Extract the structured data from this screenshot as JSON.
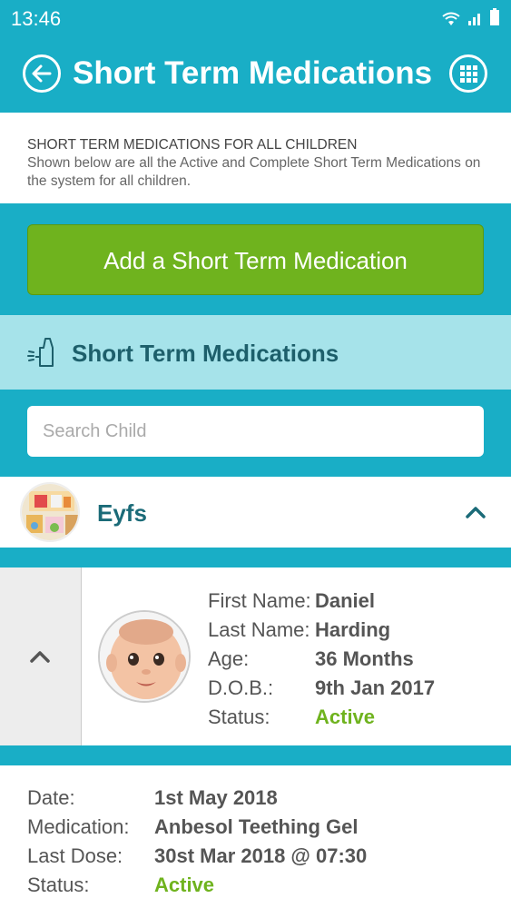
{
  "status_bar": {
    "time": "13:46"
  },
  "app_bar": {
    "title": "Short Term Medications",
    "back_icon": "back-arrow-icon",
    "menu_icon": "grid-menu-icon"
  },
  "info": {
    "heading": "SHORT TERM MEDICATIONS FOR ALL CHILDREN",
    "description": "Shown below are all the Active and Complete Short Term Medications on the system for all children."
  },
  "add_button": {
    "label": "Add a Short Term Medication"
  },
  "section": {
    "title": "Short Term Medications",
    "icon": "inhaler-icon"
  },
  "search": {
    "placeholder": "Search Child",
    "value": ""
  },
  "group": {
    "name": "Eyfs"
  },
  "child": {
    "labels": {
      "first_name": "First Name:",
      "last_name": "Last Name:",
      "age": "Age:",
      "dob": "D.O.B.:",
      "status": "Status:"
    },
    "first_name": "Daniel",
    "last_name": "Harding",
    "age": "36 Months",
    "dob": "9th Jan 2017",
    "status": "Active"
  },
  "medication": {
    "labels": {
      "date": "Date:",
      "medication": "Medication:",
      "last_dose": "Last Dose:",
      "status": "Status:"
    },
    "date": "1st May 2018",
    "name": "Anbesol Teething Gel",
    "last_dose": "30st Mar 2018 @ 07:30",
    "status": "Active"
  },
  "colors": {
    "primary": "#19aec6",
    "accent_green": "#6fb31e",
    "section_bg": "#a6e3ea",
    "section_text": "#1d5f6b"
  }
}
